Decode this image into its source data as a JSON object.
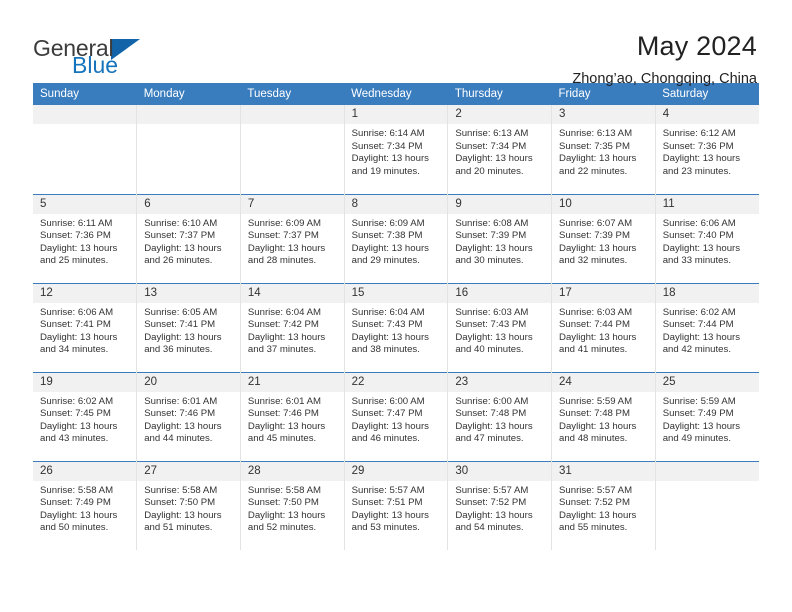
{
  "brand": {
    "name_top": "General",
    "name_bottom": "Blue",
    "accent": "#1674bd"
  },
  "header": {
    "title": "May 2024",
    "subtitle": "Zhong’ao, Chongqing, China"
  },
  "colors": {
    "header_blue": "#3a7dbf",
    "daynum_bg": "#f1f1f1",
    "text": "#333333",
    "column_divider": "#e3e3e3"
  },
  "weekday_headers": [
    "Sunday",
    "Monday",
    "Tuesday",
    "Wednesday",
    "Thursday",
    "Friday",
    "Saturday"
  ],
  "labels": {
    "sunrise_prefix": "Sunrise:",
    "sunset_prefix": "Sunset:",
    "daylight_prefix": "Daylight:"
  },
  "weeks": [
    [
      {
        "blank": true,
        "day": ""
      },
      {
        "blank": true,
        "day": ""
      },
      {
        "blank": true,
        "day": ""
      },
      {
        "blank": false,
        "day": "1",
        "sunrise": "Sunrise: 6:14 AM",
        "sunset": "Sunset: 7:34 PM",
        "daylight1": "Daylight: 13 hours",
        "daylight2": "and 19 minutes."
      },
      {
        "blank": false,
        "day": "2",
        "sunrise": "Sunrise: 6:13 AM",
        "sunset": "Sunset: 7:34 PM",
        "daylight1": "Daylight: 13 hours",
        "daylight2": "and 20 minutes."
      },
      {
        "blank": false,
        "day": "3",
        "sunrise": "Sunrise: 6:13 AM",
        "sunset": "Sunset: 7:35 PM",
        "daylight1": "Daylight: 13 hours",
        "daylight2": "and 22 minutes."
      },
      {
        "blank": false,
        "day": "4",
        "sunrise": "Sunrise: 6:12 AM",
        "sunset": "Sunset: 7:36 PM",
        "daylight1": "Daylight: 13 hours",
        "daylight2": "and 23 minutes."
      }
    ],
    [
      {
        "blank": false,
        "day": "5",
        "sunrise": "Sunrise: 6:11 AM",
        "sunset": "Sunset: 7:36 PM",
        "daylight1": "Daylight: 13 hours",
        "daylight2": "and 25 minutes."
      },
      {
        "blank": false,
        "day": "6",
        "sunrise": "Sunrise: 6:10 AM",
        "sunset": "Sunset: 7:37 PM",
        "daylight1": "Daylight: 13 hours",
        "daylight2": "and 26 minutes."
      },
      {
        "blank": false,
        "day": "7",
        "sunrise": "Sunrise: 6:09 AM",
        "sunset": "Sunset: 7:37 PM",
        "daylight1": "Daylight: 13 hours",
        "daylight2": "and 28 minutes."
      },
      {
        "blank": false,
        "day": "8",
        "sunrise": "Sunrise: 6:09 AM",
        "sunset": "Sunset: 7:38 PM",
        "daylight1": "Daylight: 13 hours",
        "daylight2": "and 29 minutes."
      },
      {
        "blank": false,
        "day": "9",
        "sunrise": "Sunrise: 6:08 AM",
        "sunset": "Sunset: 7:39 PM",
        "daylight1": "Daylight: 13 hours",
        "daylight2": "and 30 minutes."
      },
      {
        "blank": false,
        "day": "10",
        "sunrise": "Sunrise: 6:07 AM",
        "sunset": "Sunset: 7:39 PM",
        "daylight1": "Daylight: 13 hours",
        "daylight2": "and 32 minutes."
      },
      {
        "blank": false,
        "day": "11",
        "sunrise": "Sunrise: 6:06 AM",
        "sunset": "Sunset: 7:40 PM",
        "daylight1": "Daylight: 13 hours",
        "daylight2": "and 33 minutes."
      }
    ],
    [
      {
        "blank": false,
        "day": "12",
        "sunrise": "Sunrise: 6:06 AM",
        "sunset": "Sunset: 7:41 PM",
        "daylight1": "Daylight: 13 hours",
        "daylight2": "and 34 minutes."
      },
      {
        "blank": false,
        "day": "13",
        "sunrise": "Sunrise: 6:05 AM",
        "sunset": "Sunset: 7:41 PM",
        "daylight1": "Daylight: 13 hours",
        "daylight2": "and 36 minutes."
      },
      {
        "blank": false,
        "day": "14",
        "sunrise": "Sunrise: 6:04 AM",
        "sunset": "Sunset: 7:42 PM",
        "daylight1": "Daylight: 13 hours",
        "daylight2": "and 37 minutes."
      },
      {
        "blank": false,
        "day": "15",
        "sunrise": "Sunrise: 6:04 AM",
        "sunset": "Sunset: 7:43 PM",
        "daylight1": "Daylight: 13 hours",
        "daylight2": "and 38 minutes."
      },
      {
        "blank": false,
        "day": "16",
        "sunrise": "Sunrise: 6:03 AM",
        "sunset": "Sunset: 7:43 PM",
        "daylight1": "Daylight: 13 hours",
        "daylight2": "and 40 minutes."
      },
      {
        "blank": false,
        "day": "17",
        "sunrise": "Sunrise: 6:03 AM",
        "sunset": "Sunset: 7:44 PM",
        "daylight1": "Daylight: 13 hours",
        "daylight2": "and 41 minutes."
      },
      {
        "blank": false,
        "day": "18",
        "sunrise": "Sunrise: 6:02 AM",
        "sunset": "Sunset: 7:44 PM",
        "daylight1": "Daylight: 13 hours",
        "daylight2": "and 42 minutes."
      }
    ],
    [
      {
        "blank": false,
        "day": "19",
        "sunrise": "Sunrise: 6:02 AM",
        "sunset": "Sunset: 7:45 PM",
        "daylight1": "Daylight: 13 hours",
        "daylight2": "and 43 minutes."
      },
      {
        "blank": false,
        "day": "20",
        "sunrise": "Sunrise: 6:01 AM",
        "sunset": "Sunset: 7:46 PM",
        "daylight1": "Daylight: 13 hours",
        "daylight2": "and 44 minutes."
      },
      {
        "blank": false,
        "day": "21",
        "sunrise": "Sunrise: 6:01 AM",
        "sunset": "Sunset: 7:46 PM",
        "daylight1": "Daylight: 13 hours",
        "daylight2": "and 45 minutes."
      },
      {
        "blank": false,
        "day": "22",
        "sunrise": "Sunrise: 6:00 AM",
        "sunset": "Sunset: 7:47 PM",
        "daylight1": "Daylight: 13 hours",
        "daylight2": "and 46 minutes."
      },
      {
        "blank": false,
        "day": "23",
        "sunrise": "Sunrise: 6:00 AM",
        "sunset": "Sunset: 7:48 PM",
        "daylight1": "Daylight: 13 hours",
        "daylight2": "and 47 minutes."
      },
      {
        "blank": false,
        "day": "24",
        "sunrise": "Sunrise: 5:59 AM",
        "sunset": "Sunset: 7:48 PM",
        "daylight1": "Daylight: 13 hours",
        "daylight2": "and 48 minutes."
      },
      {
        "blank": false,
        "day": "25",
        "sunrise": "Sunrise: 5:59 AM",
        "sunset": "Sunset: 7:49 PM",
        "daylight1": "Daylight: 13 hours",
        "daylight2": "and 49 minutes."
      }
    ],
    [
      {
        "blank": false,
        "day": "26",
        "sunrise": "Sunrise: 5:58 AM",
        "sunset": "Sunset: 7:49 PM",
        "daylight1": "Daylight: 13 hours",
        "daylight2": "and 50 minutes."
      },
      {
        "blank": false,
        "day": "27",
        "sunrise": "Sunrise: 5:58 AM",
        "sunset": "Sunset: 7:50 PM",
        "daylight1": "Daylight: 13 hours",
        "daylight2": "and 51 minutes."
      },
      {
        "blank": false,
        "day": "28",
        "sunrise": "Sunrise: 5:58 AM",
        "sunset": "Sunset: 7:50 PM",
        "daylight1": "Daylight: 13 hours",
        "daylight2": "and 52 minutes."
      },
      {
        "blank": false,
        "day": "29",
        "sunrise": "Sunrise: 5:57 AM",
        "sunset": "Sunset: 7:51 PM",
        "daylight1": "Daylight: 13 hours",
        "daylight2": "and 53 minutes."
      },
      {
        "blank": false,
        "day": "30",
        "sunrise": "Sunrise: 5:57 AM",
        "sunset": "Sunset: 7:52 PM",
        "daylight1": "Daylight: 13 hours",
        "daylight2": "and 54 minutes."
      },
      {
        "blank": false,
        "day": "31",
        "sunrise": "Sunrise: 5:57 AM",
        "sunset": "Sunset: 7:52 PM",
        "daylight1": "Daylight: 13 hours",
        "daylight2": "and 55 minutes."
      },
      {
        "blank": true,
        "day": ""
      }
    ]
  ]
}
